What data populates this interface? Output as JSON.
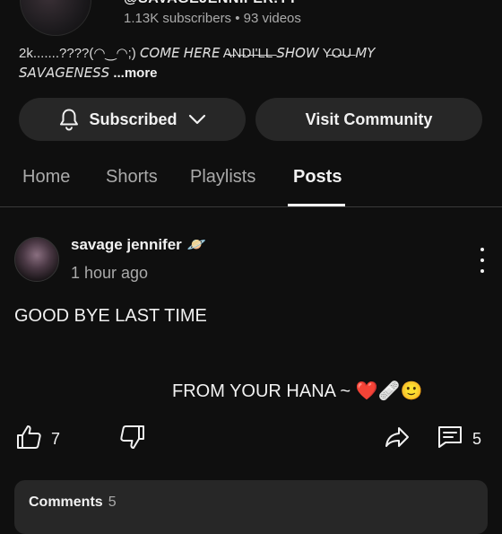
{
  "channel": {
    "handle": "@SAVAGEJENNIFER.YT",
    "subscribers": "1.13K subscribers",
    "separator": "•",
    "videos": "93 videos",
    "description": "2k.......????(◠‿◠;) 𝘊𝘖𝘔𝘌 𝘏𝘌𝘙𝘌 A̶N̶D̶I̶'̶L̶L̶ 𝘚𝘏𝘖𝘞 Y̶O̶U̶ 𝘔𝘠 𝘚𝘈𝘝𝘈𝘎𝘌𝘕𝘌𝘚𝘚",
    "more_label": "...more"
  },
  "buttons": {
    "subscribed_label": "Subscribed",
    "visit_label": "Visit Community"
  },
  "tabs": [
    {
      "label": "Home",
      "active": false
    },
    {
      "label": "Shorts",
      "active": false
    },
    {
      "label": "Playlists",
      "active": false
    },
    {
      "label": "Posts",
      "active": true
    }
  ],
  "post": {
    "author": "savage jennifer",
    "author_emoji": "🪐",
    "time": "1 hour ago",
    "line1": "GOOD BYE LAST TIME",
    "line2": "FROM YOUR HANA ~ ❤️🩹🙂",
    "likes": "7",
    "comments_count": "5"
  },
  "comments": {
    "label": "Comments",
    "count": "5"
  },
  "icons": {
    "bell": "bell-icon",
    "chevron": "chevron-down-icon",
    "kebab": "more-vertical-icon",
    "like": "thumbs-up-icon",
    "dislike": "thumbs-down-icon",
    "share": "share-icon",
    "comment": "comment-icon"
  },
  "colors": {
    "background": "#0f0f0f",
    "button_bg": "#272727",
    "text_primary": "#f1f1f1",
    "text_secondary": "#aaaaaa"
  }
}
